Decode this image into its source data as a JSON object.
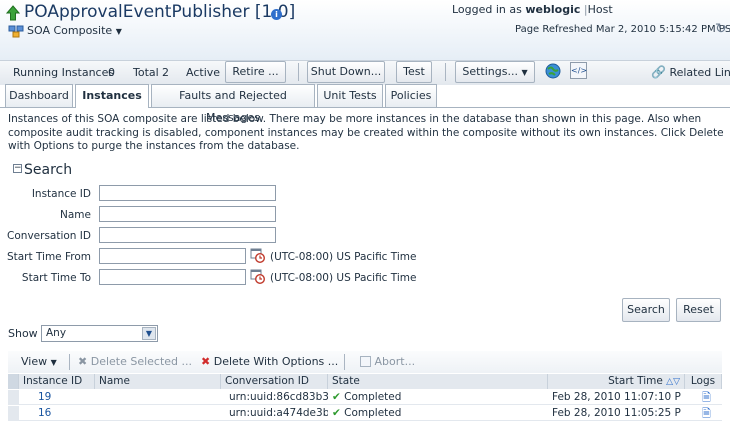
{
  "header": {
    "title": "POApprovalEventPublisher [1.0]",
    "menu_label": "SOA Composite",
    "logged_in_prefix": "Logged in as",
    "user": "weblogic",
    "host": "Host",
    "page_refreshed": "Page Refreshed Mar 2, 2010 5:15:42 PM PST"
  },
  "toolbar": {
    "running_instances_label": "Running Instances",
    "running_instances_value": "0",
    "total_label": "Total",
    "total_value": "2",
    "state_label": "Active",
    "retire_label": "Retire ...",
    "shutdown_label": "Shut Down...",
    "test_label": "Test",
    "settings_label": "Settings...",
    "related_links_label": "Related Links"
  },
  "tabs": [
    {
      "label": "Dashboard",
      "active": false
    },
    {
      "label": "Instances",
      "active": true
    },
    {
      "label": "Faults and Rejected Messages",
      "active": false
    },
    {
      "label": "Unit Tests",
      "active": false
    },
    {
      "label": "Policies",
      "active": false
    }
  ],
  "description": "Instances of this SOA composite are listed below. There may be more instances in the database than shown in this page. Also when composite audit tracking is disabled, component instances may be created within the composite without its own instances. Click Delete with Options to purge the instances from the database.",
  "search": {
    "heading": "Search",
    "instance_id_label": "Instance ID",
    "name_label": "Name",
    "conversation_id_label": "Conversation ID",
    "start_from_label": "Start Time From",
    "start_to_label": "Start Time To",
    "timezone": "(UTC-08:00) US Pacific Time",
    "search_button": "Search",
    "reset_button": "Reset"
  },
  "show": {
    "label": "Show",
    "value": "Any"
  },
  "table_toolbar": {
    "view_label": "View",
    "delete_selected_label": "Delete Selected ...",
    "delete_options_label": "Delete With Options ...",
    "abort_label": "Abort..."
  },
  "table": {
    "columns": {
      "instance_id": "Instance ID",
      "name": "Name",
      "conversation_id": "Conversation ID",
      "state": "State",
      "start_time": "Start Time",
      "logs": "Logs"
    },
    "rows": [
      {
        "instance_id": "19",
        "name": "",
        "conversation_id": "urn:uuid:86cd83b3-!",
        "state": "Completed",
        "start_time": "Feb 28, 2010 11:07:10 PM"
      },
      {
        "instance_id": "16",
        "name": "",
        "conversation_id": "urn:uuid:a474de3b-",
        "state": "Completed",
        "start_time": "Feb 28, 2010 11:05:25 PM"
      }
    ]
  },
  "colors": {
    "accent": "#1a55a0",
    "success": "#2e9a2e",
    "danger": "#d12c2c"
  }
}
